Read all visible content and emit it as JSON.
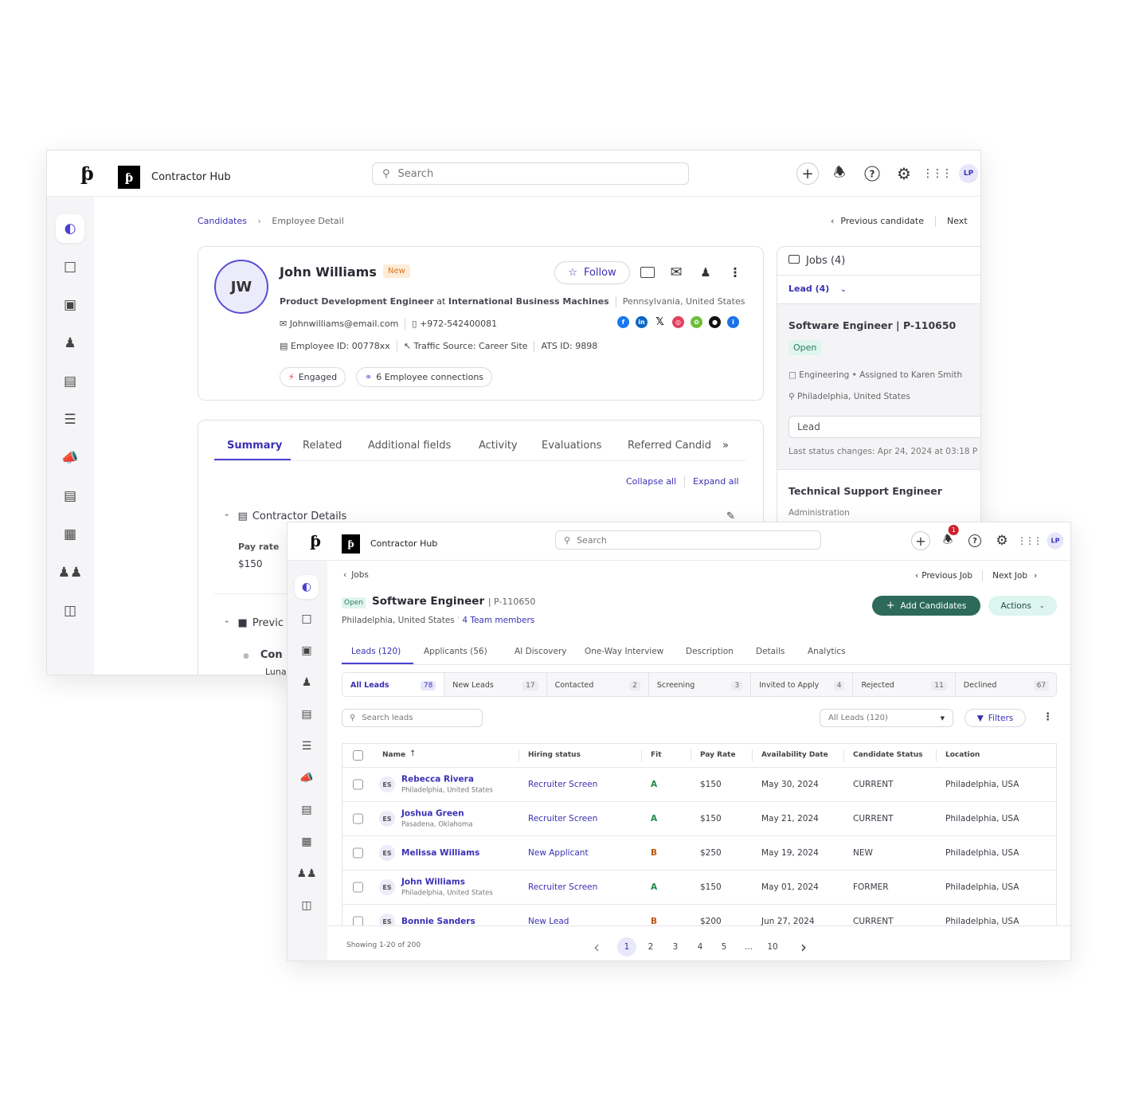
{
  "colors": {
    "accent": "#3b30b5",
    "primary_button": "#2d6a5a",
    "actions_bg": "#dcf5ee",
    "open_badge": "#dff5ee",
    "fit_a": "#1a8a4a",
    "fit_b": "#c0560f",
    "new_badge_bg": "#fdecd6",
    "new_badge_text": "#d9731c"
  },
  "back": {
    "app_name": "Contractor Hub",
    "search_placeholder": "Search",
    "avatar": "LP",
    "breadcrumb": {
      "parent": "Candidates",
      "current": "Employee Detail"
    },
    "nav": {
      "previous": "Previous candidate",
      "next": "Next"
    },
    "profile": {
      "initials": "JW",
      "name": "John Williams",
      "badge": "New",
      "follow": "Follow",
      "title": "Product Development Engineer",
      "at": "at",
      "company": "International Business Machines",
      "location": "Pennsylvania, United States",
      "email": "Johnwilliams@email.com",
      "phone": "+972-542400081",
      "employee_id": "Employee ID: 00778xx",
      "traffic_source": "Traffic Source: Career Site",
      "ats_id": "ATS ID: 9898",
      "engaged": "Engaged",
      "connections": "6 Employee connections",
      "socials": [
        "facebook-icon",
        "linkedin-icon",
        "x-icon",
        "instagram-icon",
        "wechat-icon",
        "github-icon",
        "info-icon"
      ]
    },
    "tabs": [
      "Summary",
      "Related",
      "Additional fields",
      "Activity",
      "Evaluations",
      "Referred Candid"
    ],
    "collapse_all": "Collapse all",
    "expand_all": "Expand all",
    "section_contractor": "Contractor Details",
    "pay_rate_label": "Pay rate",
    "pay_rate_value": "$150",
    "section_previous": "Previc",
    "sub_item": "Con",
    "sub_item2": "Luna",
    "jobs": {
      "header": "Jobs (4)",
      "filter": "Lead (4)",
      "job1": {
        "title": "Software Engineer | P-110650",
        "status": "Open",
        "dept": "Engineering • Assigned to Karen Smith",
        "location": "Philadelphia, United States",
        "stage": "Lead",
        "last_change": "Last status changes: Apr 24, 2024 at 03:18 P"
      },
      "job2": {
        "title": "Technical Support Engineer",
        "dept": "Administration"
      }
    }
  },
  "front": {
    "app_name": "Contractor Hub",
    "search_placeholder": "Search",
    "avatar": "LP",
    "notification_count": "1",
    "back_link": "Jobs",
    "nav": {
      "previous": "Previous Job",
      "next": "Next Job"
    },
    "job": {
      "status": "Open",
      "title": "Software Engineer",
      "id": "| P-110650",
      "location": "Philadelphia, United States",
      "team": "4 Team members"
    },
    "add_candidates": "Add Candidates",
    "actions": "Actions",
    "tabs": [
      "Leads (120)",
      "Applicants (56)",
      "AI Discovery",
      "One-Way Interview",
      "Description",
      "Details",
      "Analytics"
    ],
    "chips": [
      {
        "label": "All Leads",
        "count": "78"
      },
      {
        "label": "New Leads",
        "count": "17"
      },
      {
        "label": "Contacted",
        "count": "2"
      },
      {
        "label": "Screening",
        "count": "3"
      },
      {
        "label": "Invited to Apply",
        "count": "4"
      },
      {
        "label": "Rejected",
        "count": "11"
      },
      {
        "label": "Declined",
        "count": "67"
      }
    ],
    "search_leads_placeholder": "Search leads",
    "view_select": "All Leads (120)",
    "filters": "Filters",
    "columns": [
      "Name",
      "Hiring status",
      "Fit",
      "Pay Rate",
      "Availability Date",
      "Candidate Status",
      "Location"
    ],
    "rows": [
      {
        "initials": "ES",
        "name": "Rebecca Rivera",
        "sub": "Philadelphia, United States",
        "hiring": "Recruiter Screen",
        "fit": "A",
        "pay": "$150",
        "date": "May 30, 2024",
        "status": "CURRENT",
        "location": "Philadelphia, USA"
      },
      {
        "initials": "ES",
        "name": "Joshua Green",
        "sub": "Pasadena, Oklahoma",
        "hiring": "Recruiter Screen",
        "fit": "A",
        "pay": "$150",
        "date": "May 21, 2024",
        "status": "CURRENT",
        "location": "Philadelphia, USA"
      },
      {
        "initials": "ES",
        "name": "Melissa Williams",
        "sub": "",
        "hiring": "New Applicant",
        "fit": "B",
        "pay": "$250",
        "date": "May 19, 2024",
        "status": "NEW",
        "location": "Philadelphia, USA"
      },
      {
        "initials": "ES",
        "name": "John Williams",
        "sub": "Philadelphia, United States",
        "hiring": "Recruiter Screen",
        "fit": "A",
        "pay": "$150",
        "date": "May 01, 2024",
        "status": "FORMER",
        "location": "Philadelphia, USA"
      },
      {
        "initials": "ES",
        "name": "Bonnie Sanders",
        "sub": "",
        "hiring": "New Lead",
        "fit": "B",
        "pay": "$200",
        "date": "Jun 27, 2024",
        "status": "CURRENT",
        "location": "Philadelphia, USA"
      }
    ],
    "showing": "Showing 1-20 of 200",
    "pages": [
      "1",
      "2",
      "3",
      "4",
      "5",
      "...",
      "10"
    ],
    "current_page": "1"
  }
}
